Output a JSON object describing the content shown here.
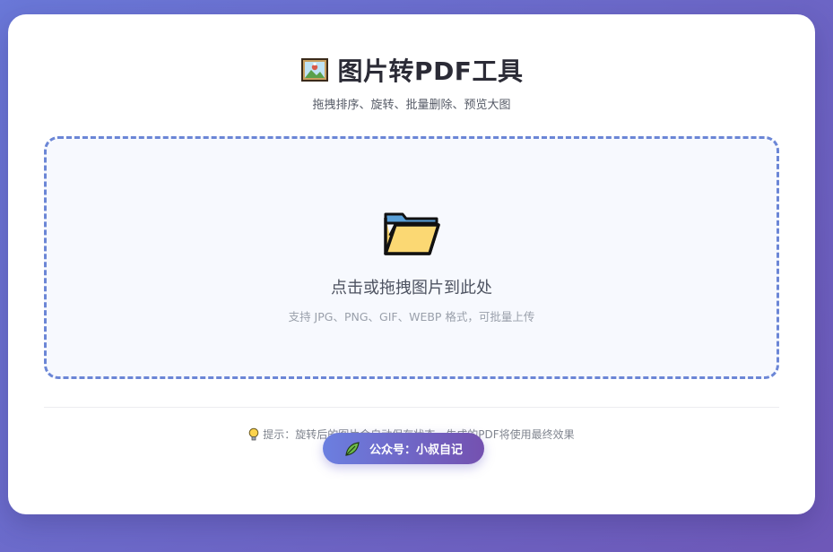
{
  "header": {
    "icon": "framed-picture-icon",
    "title": "图片转PDF工具",
    "subtitle": "拖拽排序、旋转、批量删除、预览大图"
  },
  "dropzone": {
    "icon": "folder-icon",
    "text": "点击或拖拽图片到此处",
    "hint": "支持 JPG、PNG、GIF、WEBP 格式，可批量上传"
  },
  "footer": {
    "tip_icon": "lightbulb-icon",
    "tip": "提示：旋转后的图片会自动保存状态，生成的PDF将使用最终效果",
    "badge_icon": "leaf-icon",
    "badge": "公众号：小叔自记"
  },
  "colors": {
    "accent": "#6b86d6",
    "background_start": "#6a78d8",
    "background_end": "#6e58b8"
  }
}
